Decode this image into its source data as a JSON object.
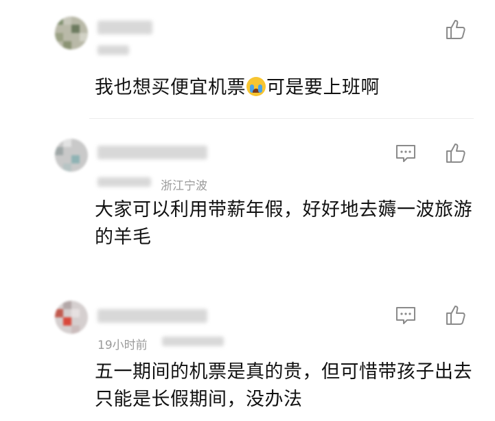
{
  "comments": [
    {
      "location": "",
      "time": "",
      "text": "我也想买便宜机票",
      "text_after_emoji": "可是要上班啊",
      "emoji_icon": "crying-face-icon",
      "has_reply_icon": false
    },
    {
      "location": "浙江宁波",
      "time": "",
      "text": "大家可以利用带薪年假，好好地去薅一波旅游的羊毛",
      "has_reply_icon": true
    },
    {
      "location": "",
      "time": "19小时前",
      "text": "五一期间的机票是真的贵，但可惜带孩子出去只能是长假期间，没办法",
      "has_reply_icon": true
    }
  ],
  "icons": {
    "like": "thumbs-up-icon",
    "reply": "comment-bubble-icon"
  },
  "colors": {
    "meta": "#9a9a9a",
    "text": "#111111",
    "icon": "#8a8a8a"
  }
}
